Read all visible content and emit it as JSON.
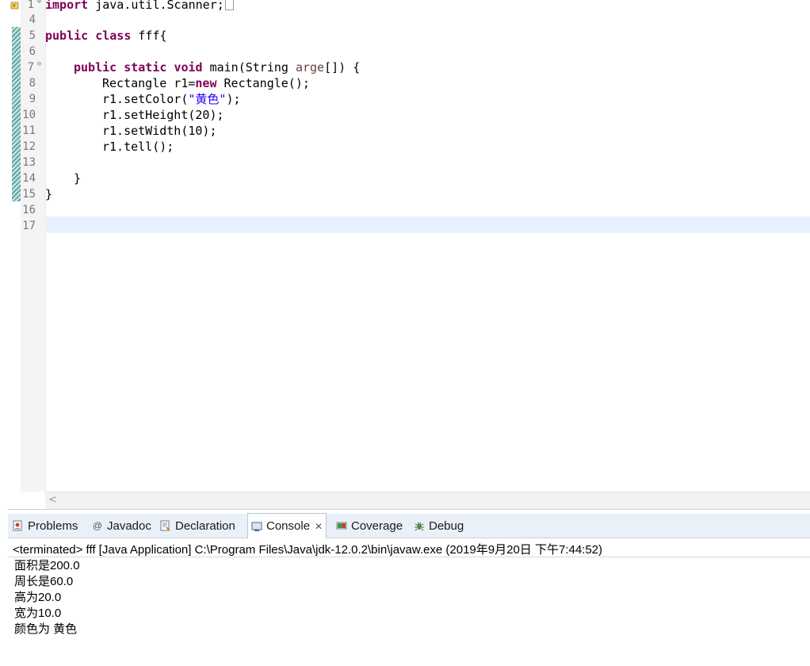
{
  "editor": {
    "lines": [
      {
        "num": "1",
        "top": 0
      },
      {
        "num": "4"
      },
      {
        "num": "5"
      },
      {
        "num": "6"
      },
      {
        "num": "7"
      },
      {
        "num": "8"
      },
      {
        "num": "9"
      },
      {
        "num": "10"
      },
      {
        "num": "11"
      },
      {
        "num": "12"
      },
      {
        "num": "13"
      },
      {
        "num": "14"
      },
      {
        "num": "15"
      },
      {
        "num": "16"
      },
      {
        "num": "17"
      }
    ],
    "code": {
      "l1_kw": "import",
      "l1_rest": " java.util.Scanner;",
      "l5_kw1": "public",
      "l5_kw2": "class",
      "l5_rest": " fff{",
      "l7_kw1": "public",
      "l7_kw2": "static",
      "l7_kw3": "void",
      "l7_mid": " main(String ",
      "l7_param": "arge",
      "l7_end": "[]) {",
      "l8_a": "Rectangle r1=",
      "l8_kw": "new",
      "l8_b": " Rectangle();",
      "l9_a": "r1.setColor(",
      "l9_str": "\"黄色\"",
      "l9_b": ");",
      "l10": "r1.setHeight(20);",
      "l11": "r1.setWidth(10);",
      "l12": "r1.tell();",
      "l14": "}",
      "l15": "}"
    },
    "fold_glyph": "⊕",
    "collapse_glyph": "⊖",
    "scroll_left_glyph": "<"
  },
  "panel": {
    "tabs": [
      {
        "label": "Problems"
      },
      {
        "label": "Javadoc"
      },
      {
        "label": "Declaration"
      },
      {
        "label": "Console",
        "close": "✕"
      },
      {
        "label": "Coverage"
      },
      {
        "label": "Debug"
      }
    ],
    "console_header": "<terminated> fff [Java Application] C:\\Program Files\\Java\\jdk-12.0.2\\bin\\javaw.exe (2019年9月20日 下午7:44:52)",
    "output": [
      "面积是200.0",
      "周长是60.0",
      "高为20.0",
      "宽为10.0",
      "颜色为 黄色"
    ]
  },
  "colors": {
    "keyword": "#7f0055",
    "string": "#2a00ff",
    "current_line": "#e8f2fe",
    "tab_bar": "#eaf0f8"
  }
}
